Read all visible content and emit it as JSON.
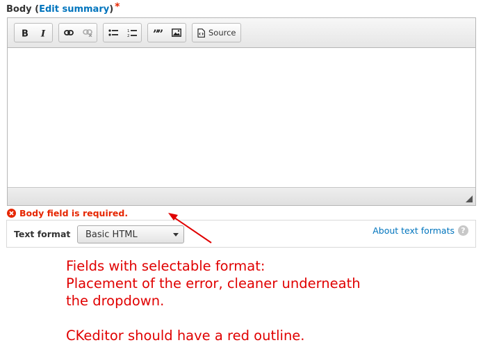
{
  "field": {
    "label": "Body",
    "edit_summary_link": "Edit summary",
    "required_marker": "*"
  },
  "toolbar": {
    "bold_icon": "bold-icon",
    "italic_icon": "italic-icon",
    "link_icon": "link-icon",
    "unlink_icon": "unlink-icon",
    "bulleted_list_icon": "bulleted-list-icon",
    "numbered_list_icon": "numbered-list-icon",
    "blockquote_icon": "blockquote-icon",
    "image_icon": "image-icon",
    "source_label": "Source"
  },
  "error": {
    "message": "Body field is required.",
    "color": "#e62600"
  },
  "text_format": {
    "label": "Text format",
    "selected": "Basic HTML",
    "about_link": "About text formats"
  },
  "annotation": {
    "color": "#e00000",
    "lines": [
      "Fields with selectable format:",
      "Placement of the error, cleaner underneath",
      "the dropdown.",
      "",
      "CKeditor should have a red outline."
    ]
  }
}
